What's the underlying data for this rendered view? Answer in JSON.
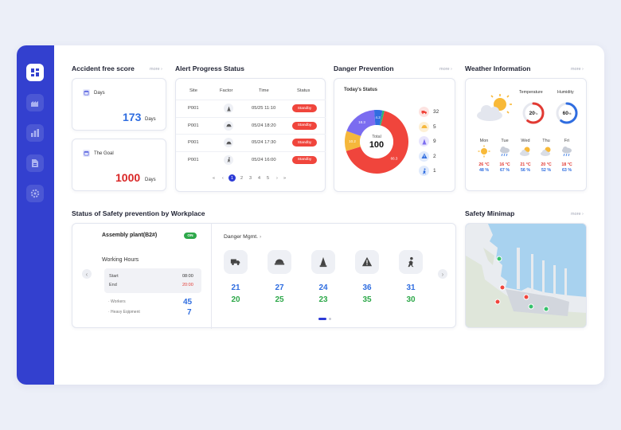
{
  "sidebar": {
    "items": [
      {
        "icon": "dashboard-icon",
        "active": true
      },
      {
        "icon": "workplace-icon",
        "active": false
      },
      {
        "icon": "chart-icon",
        "active": false
      },
      {
        "icon": "document-icon",
        "active": false
      },
      {
        "icon": "settings-icon",
        "active": false
      }
    ]
  },
  "accident": {
    "title": "Accident free score",
    "more": "more",
    "days_label": "Days",
    "days_value": "173",
    "days_unit": "Days",
    "goal_label": "The Goal",
    "goal_value": "1000",
    "goal_unit": "Days"
  },
  "alert": {
    "title": "Alert Progress Status",
    "columns": [
      "Site",
      "Factor",
      "Time",
      "Status"
    ],
    "rows": [
      {
        "site": "P001",
        "factor_icon": "cone-icon",
        "time": "05/25 11:10",
        "status": "Standby"
      },
      {
        "site": "P001",
        "factor_icon": "helmet-icon",
        "time": "05/24 18:20",
        "status": "Standby"
      },
      {
        "site": "P001",
        "factor_icon": "helmet-icon",
        "time": "05/24 17:30",
        "status": "Standby"
      },
      {
        "site": "P001",
        "factor_icon": "worker-icon",
        "time": "05/24 16:00",
        "status": "Standby"
      }
    ],
    "pagination": {
      "first": "«",
      "prev": "‹",
      "pages": [
        "1",
        "2",
        "3",
        "4",
        "5"
      ],
      "current": "1",
      "next": "›",
      "last": "»"
    }
  },
  "danger": {
    "title": "Danger Prevention",
    "more": "more",
    "subtitle": "Today's Status",
    "total_label": "Total",
    "total_value": "100",
    "donut": [
      {
        "value": 66.3,
        "label": "66.3",
        "color": "#f0453c"
      },
      {
        "value": 10.2,
        "label": "10.2",
        "color": "#f5b73b"
      },
      {
        "value": 18.3,
        "label": "18.3",
        "color": "#7b6cf0"
      },
      {
        "value": 4.2,
        "label": "4.2",
        "color": "#2f6de0"
      },
      {
        "value": 1.0,
        "label": "",
        "color": "#2bb673"
      }
    ],
    "legend": [
      {
        "icon": "truck-icon",
        "value": "32",
        "bg": "#fde3e1",
        "fg": "#f0453c"
      },
      {
        "icon": "helmet-icon",
        "value": "5",
        "bg": "#fdf0d6",
        "fg": "#f5b73b"
      },
      {
        "icon": "cone-icon",
        "value": "9",
        "bg": "#e8e5fd",
        "fg": "#7b6cf0"
      },
      {
        "icon": "warning-icon",
        "value": "2",
        "bg": "#e1ebfc",
        "fg": "#2f6de0"
      },
      {
        "icon": "worker-icon",
        "value": "1",
        "bg": "#e1ebfc",
        "fg": "#2f6de0"
      }
    ]
  },
  "weather": {
    "title": "Weather Information",
    "more": "more",
    "temp_label": "Temperature",
    "temp_value": "20",
    "temp_unit": "°c",
    "temp_fraction": 0.6,
    "humidity_label": "Humidity",
    "humidity_value": "60",
    "humidity_unit": "%",
    "humidity_fraction": 0.6,
    "days": [
      {
        "name": "Mon",
        "icon": "sun-icon",
        "temp": "26 °C",
        "hum": "48 %"
      },
      {
        "name": "Tue",
        "icon": "rain-icon",
        "temp": "16 °C",
        "hum": "67 %"
      },
      {
        "name": "Wed",
        "icon": "partly-cloudy-icon",
        "temp": "21 °C",
        "hum": "56 %"
      },
      {
        "name": "Thu",
        "icon": "partly-cloudy-icon",
        "temp": "20 °C",
        "hum": "52 %"
      },
      {
        "name": "Fri",
        "icon": "rain-icon",
        "temp": "18 °C",
        "hum": "63 %"
      }
    ]
  },
  "workplace": {
    "title": "Status of Safety prevention by Workplace",
    "plant_name": "Assembly plant(B2#)",
    "plant_status": "ON",
    "working_hours_label": "Working Hours",
    "start_label": "Start",
    "start_value": "08:00",
    "end_label": "End",
    "end_value": "20:00",
    "workers_label": "· Workers",
    "workers_value": "45",
    "equipment_label": "· Heavy Eqipment",
    "equipment_value": "7",
    "danger_mgmt_label": "Danger Mgmt.",
    "danger_mgmt_chevron": "›",
    "items": [
      {
        "icon": "truck-icon",
        "blue": "21",
        "green": "20"
      },
      {
        "icon": "helmet-icon",
        "blue": "27",
        "green": "25"
      },
      {
        "icon": "cone-icon",
        "blue": "24",
        "green": "23"
      },
      {
        "icon": "warning-icon",
        "blue": "36",
        "green": "35"
      },
      {
        "icon": "worker-icon",
        "blue": "31",
        "green": "30"
      }
    ]
  },
  "minimap": {
    "title": "Safety Minimap",
    "more": "more"
  },
  "colors": {
    "accent": "#3340cf",
    "danger": "#f0453c",
    "blue": "#2f6de0",
    "green": "#2ea84a"
  }
}
